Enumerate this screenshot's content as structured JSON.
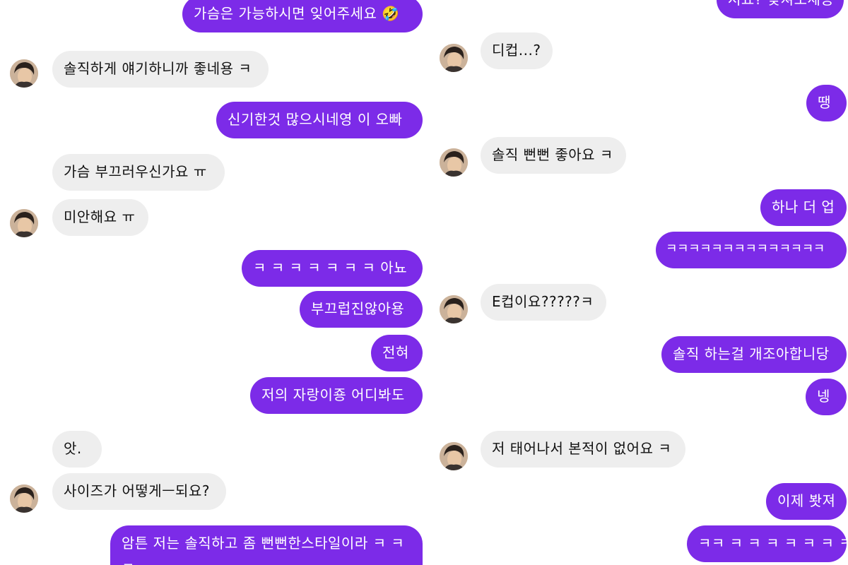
{
  "left": {
    "messages": [
      {
        "text": "가슴은 가능하시면 잊어주세요",
        "emoji": "🤣",
        "side": "sent"
      },
      {
        "text": "솔직하게 얘기하니까 좋네용 ㅋ",
        "side": "recv"
      },
      {
        "text": "신기한것 많으시네영 이 오빠",
        "side": "sent"
      },
      {
        "text": "가슴 부끄러우신가요 ㅠ",
        "side": "recv"
      },
      {
        "text": "미안해요 ㅠ",
        "side": "recv"
      },
      {
        "text": "ㅋ ㅋ ㅋ ㅋ ㅋ ㅋ ㅋ 아뇨",
        "side": "sent"
      },
      {
        "text": "부끄럽진않아용",
        "side": "sent"
      },
      {
        "text": "전혀",
        "side": "sent"
      },
      {
        "text": "저의 자랑이죵 어디봐도",
        "side": "sent"
      },
      {
        "text": "앗.",
        "side": "recv"
      },
      {
        "text": "사이즈가 어떻게ㅡ되요?",
        "side": "recv"
      },
      {
        "text": "암튼 저는 솔직하고 좀 뻔뻔한스타일이라 ㅋ ㅋ",
        "side": "sent"
      },
      {
        "text": "ㅋ",
        "side": "sent"
      }
    ]
  },
  "right": {
    "messages": [
      {
        "text": "저요? 맞쳐보세용",
        "side": "sent"
      },
      {
        "text": "디컵...?",
        "side": "recv"
      },
      {
        "text": "땡",
        "side": "sent"
      },
      {
        "text": "솔직 뻔뻔 좋아요 ㅋ",
        "side": "recv"
      },
      {
        "text": "하나 더 업",
        "side": "sent"
      },
      {
        "text": "ㅋㅋㅋㅋㅋㅋㅋㅋㅋㅋㅋㅋㅋㅋ",
        "side": "sent"
      },
      {
        "text": "E컵이요?????ㅋ",
        "side": "recv"
      },
      {
        "text": "솔직 하는걸 개조아합니당",
        "side": "sent"
      },
      {
        "text": "넹",
        "side": "sent"
      },
      {
        "text": "저 태어나서 본적이 없어요 ㅋ",
        "side": "recv"
      },
      {
        "text": "이제 봣져",
        "side": "sent"
      },
      {
        "text": "ㅋㅋ ㅋ ㅋ ㅋ ㅋ ㅋ ㅋ ㅋ",
        "side": "sent"
      }
    ]
  },
  "colors": {
    "sent_bubble": "#7c2be8",
    "received_bubble": "#eeeeee",
    "background": "#ffffff"
  },
  "icons": {
    "avatar": "profile-avatar",
    "emoji": "rolling-on-floor-laughing"
  }
}
